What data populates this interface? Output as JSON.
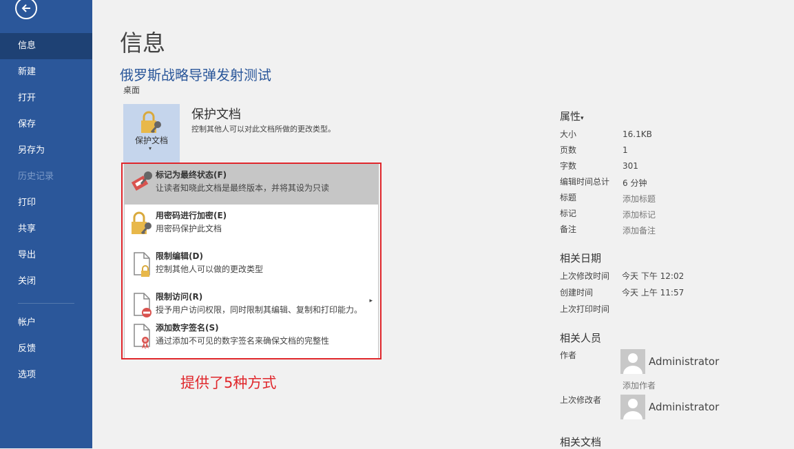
{
  "sidebar": {
    "back_icon": "arrow-left-icon",
    "items": [
      {
        "label": "信息",
        "active": true
      },
      {
        "label": "新建"
      },
      {
        "label": "打开"
      },
      {
        "label": "保存"
      },
      {
        "label": "另存为"
      },
      {
        "label": "历史记录",
        "disabled": true
      },
      {
        "label": "打印"
      },
      {
        "label": "共享"
      },
      {
        "label": "导出"
      },
      {
        "label": "关闭"
      },
      {
        "label": "帐户"
      },
      {
        "label": "反馈"
      },
      {
        "label": "选项"
      }
    ]
  },
  "main": {
    "page_title": "信息",
    "doc_title": "俄罗斯战略导弹发射测试",
    "doc_location": "桌面",
    "protect": {
      "button_label": "保护文档",
      "title": "保护文档",
      "description": "控制其他人可以对此文档所做的更改类型。"
    },
    "menu": [
      {
        "title": "标记为最终状态(F)",
        "desc": "让读者知晓此文档是最终版本，并将其设为只读",
        "icon": "pin-stamp-icon"
      },
      {
        "title": "用密码进行加密(E)",
        "desc": "用密码保护此文档",
        "icon": "lock-key-icon"
      },
      {
        "title": "限制编辑(D)",
        "desc": "控制其他人可以做的更改类型",
        "icon": "page-lock-icon"
      },
      {
        "title": "限制访问(R)",
        "desc": "授予用户访问权限，同时限制其编辑、复制和打印能力。",
        "icon": "page-restrict-icon"
      },
      {
        "title": "添加数字签名(S)",
        "desc": "通过添加不可见的数字签名来确保文档的完整性",
        "icon": "page-ribbon-icon"
      }
    ],
    "annotation": "提供了5种方式"
  },
  "properties": {
    "heading": "属性",
    "rows": [
      {
        "label": "大小",
        "value": "16.1KB"
      },
      {
        "label": "页数",
        "value": "1"
      },
      {
        "label": "字数",
        "value": "301"
      },
      {
        "label": "编辑时间总计",
        "value": "6 分钟"
      },
      {
        "label": "标题",
        "value": "添加标题"
      },
      {
        "label": "标记",
        "value": "添加标记"
      },
      {
        "label": "备注",
        "value": "添加备注"
      }
    ],
    "dates_heading": "相关日期",
    "dates": [
      {
        "label": "上次修改时间",
        "value": "今天 下午 12:02"
      },
      {
        "label": "创建时间",
        "value": "今天 上午 11:57"
      },
      {
        "label": "上次打印时间",
        "value": ""
      }
    ],
    "people_heading": "相关人员",
    "author_label": "作者",
    "author_name": "Administrator",
    "add_author": "添加作者",
    "modifier_label": "上次修改者",
    "modifier_name": "Administrator",
    "docs_heading": "相关文档"
  },
  "colors": {
    "sidebar": "#2b579a",
    "sidebar_active": "#1e4174",
    "accent_red": "#e0262b",
    "title_blue": "#2b579a"
  }
}
